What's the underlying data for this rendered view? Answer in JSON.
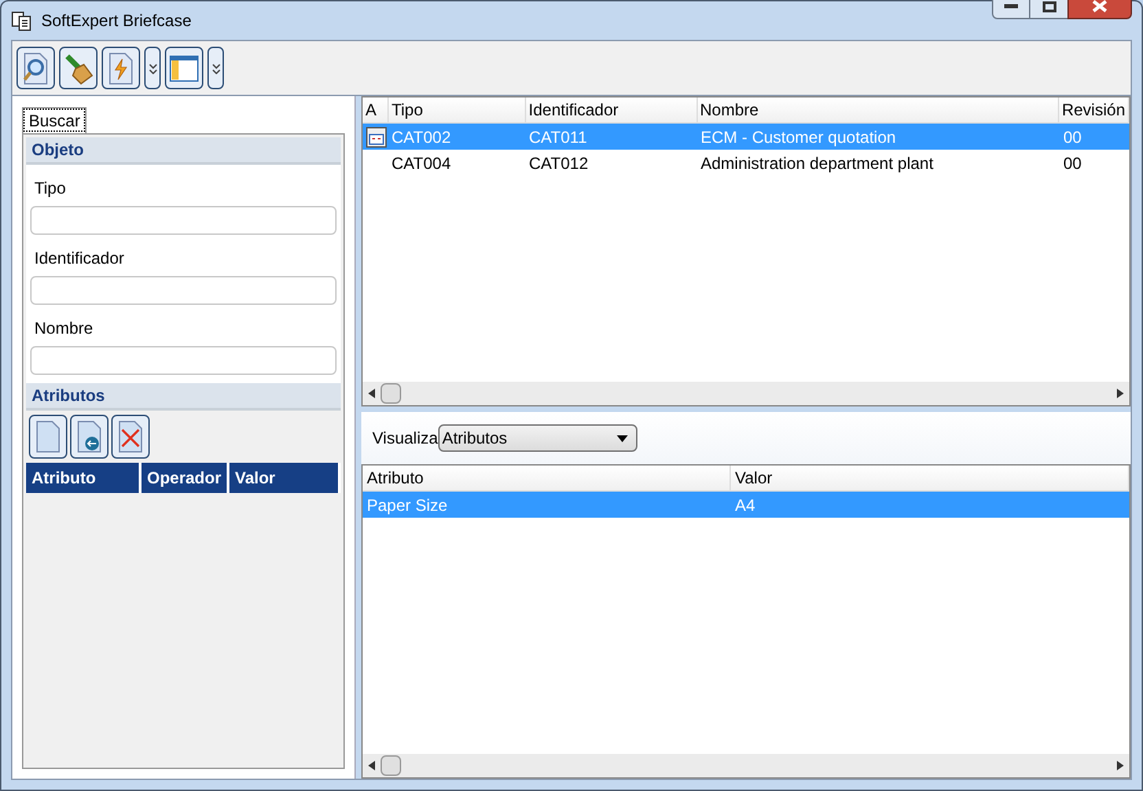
{
  "window": {
    "title": "SoftExpert Briefcase"
  },
  "search_panel": {
    "tab": {
      "label": "Buscar",
      "selected": true
    },
    "object_section": {
      "title": "Objeto",
      "fields": [
        {
          "label": "Tipo"
        },
        {
          "label": "Identificador"
        },
        {
          "label": "Nombre"
        }
      ]
    },
    "attributes_section": {
      "title": "Atributos",
      "columns": [
        "Atributo",
        "Operador",
        "Valor"
      ]
    }
  },
  "results": {
    "columns": [
      "A",
      "Tipo",
      "Identificador",
      "Nombre",
      "Revisión"
    ],
    "rows": [
      {
        "has_icon": true,
        "selected": true,
        "cells": [
          "",
          "CAT002",
          "CAT011",
          "ECM - Customer quotation",
          "00"
        ]
      },
      {
        "has_icon": false,
        "selected": false,
        "cells": [
          "",
          "CAT004",
          "CAT012",
          "Administration department plant",
          "00"
        ]
      }
    ]
  },
  "view": {
    "label": "Visualiza",
    "value": "Atributos"
  },
  "details": {
    "columns": [
      "Atributo",
      "Valor"
    ],
    "rows": [
      {
        "selected": true,
        "cells": [
          "Paper Size",
          "A4"
        ]
      }
    ]
  }
}
